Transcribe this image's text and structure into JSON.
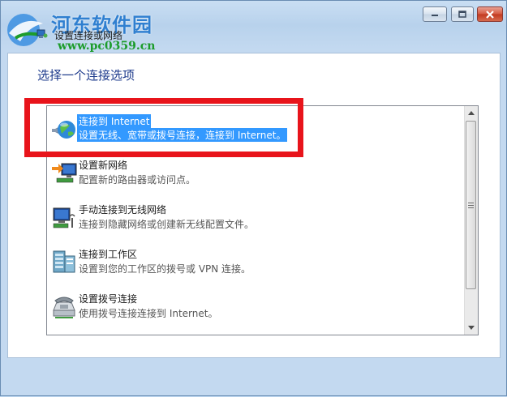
{
  "watermark": {
    "brand_text": "河东软件园",
    "url_text": "www.pc0359.cn"
  },
  "window": {
    "title": "设置连接或网络",
    "minimize_symbol": "—",
    "maximize_symbol": "□",
    "close_symbol": "✕"
  },
  "instruction": "选择一个连接选项",
  "options": [
    {
      "label": "连接到 Internet",
      "desc": "设置无线、宽带或拨号连接，连接到 Internet。",
      "icon": "globe-network-icon",
      "selected": true
    },
    {
      "label": "设置新网络",
      "desc": "配置新的路由器或访问点。",
      "icon": "new-network-icon",
      "selected": false
    },
    {
      "label": "手动连接到无线网络",
      "desc": "连接到隐藏网络或创建新无线配置文件。",
      "icon": "wireless-network-icon",
      "selected": false
    },
    {
      "label": "连接到工作区",
      "desc": "设置到您的工作区的拨号或 VPN 连接。",
      "icon": "workplace-vpn-icon",
      "selected": false
    },
    {
      "label": "设置拨号连接",
      "desc": "使用拨号连接连接到 Internet。",
      "icon": "dialup-phone-icon",
      "selected": false
    }
  ],
  "colors": {
    "selection": "#3399ff",
    "highlight_box": "#e8141b",
    "instruction_text": "#1e3b8c"
  }
}
